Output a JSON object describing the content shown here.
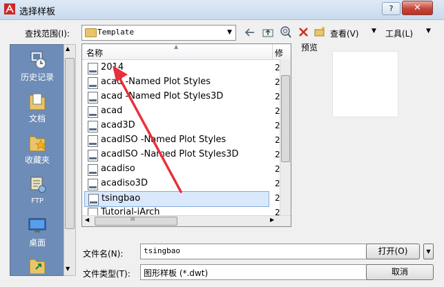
{
  "window": {
    "title": "选择样板",
    "help_label": "?",
    "close_label": "✕"
  },
  "lookin": {
    "label": "查找范围(I):",
    "value": "Template",
    "arrow": "▼"
  },
  "toolbar": {
    "back_icon": "back-arrow-icon",
    "up_icon": "up-folder-icon",
    "search_icon": "search-web-icon",
    "delete_icon": "delete-icon",
    "newfolder_icon": "new-folder-icon",
    "views_label": "查看(V)",
    "views_arrow": "▼",
    "tools_label": "工具(L)",
    "tools_arrow": "▼"
  },
  "places": [
    {
      "label": "历史记录",
      "icon": "history-icon"
    },
    {
      "label": "文档",
      "icon": "documents-folder-icon"
    },
    {
      "label": "收藏夹",
      "icon": "favorites-folder-icon"
    },
    {
      "label": "FTP",
      "icon": "ftp-icon"
    },
    {
      "label": "桌面",
      "icon": "desktop-icon"
    }
  ],
  "filelist": {
    "col_name": "名称",
    "col_modified": "修",
    "sort_glyph": "▲",
    "rows": [
      {
        "name": "2014",
        "mod": "2"
      },
      {
        "name": "acad -Named Plot Styles",
        "mod": "2"
      },
      {
        "name": "acad -Named Plot Styles3D",
        "mod": "2"
      },
      {
        "name": "acad",
        "mod": "2"
      },
      {
        "name": "acad3D",
        "mod": "2"
      },
      {
        "name": "acadISO -Named Plot Styles",
        "mod": "2"
      },
      {
        "name": "acadISO -Named Plot Styles3D",
        "mod": "2"
      },
      {
        "name": "acadiso",
        "mod": "2"
      },
      {
        "name": "acadiso3D",
        "mod": "2"
      },
      {
        "name": "tsingbao",
        "mod": "2",
        "selected": true
      },
      {
        "name": "Tutorial-iArch",
        "mod": "2"
      }
    ],
    "hthumb_grip": "III"
  },
  "preview": {
    "label": "预览"
  },
  "bottom": {
    "filename_label": "文件名(N):",
    "filename_value": "tsingbao",
    "open_label": "打开(O)",
    "open_arrow": "▼",
    "filetype_label": "文件类型(T):",
    "filetype_value": "图形样板 (*.dwt)",
    "cancel_label": "取消"
  },
  "colors": {
    "accent": "#e8303a",
    "places_bg": "#6e8cb8",
    "selection": "#d9e8fb"
  }
}
